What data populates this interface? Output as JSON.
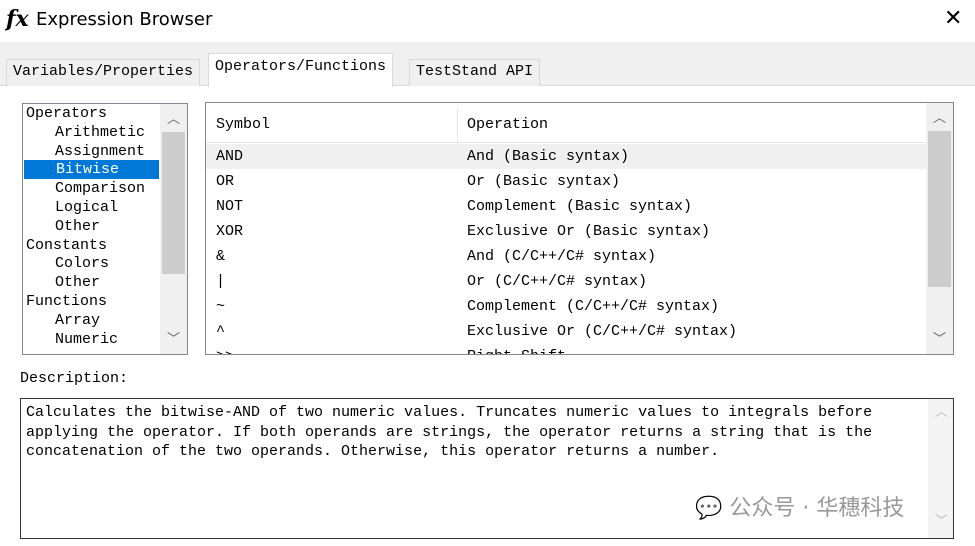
{
  "window": {
    "title": "Expression Browser",
    "icon": "fx-icon",
    "close": "✕"
  },
  "tabs": [
    {
      "label": "Variables/Properties"
    },
    {
      "label": "Operators/Functions",
      "active": true
    },
    {
      "label": "TestStand API"
    }
  ],
  "tree": {
    "items": [
      {
        "label": "Operators",
        "level": 0
      },
      {
        "label": "Arithmetic",
        "level": 1
      },
      {
        "label": "Assignment",
        "level": 1
      },
      {
        "label": "Bitwise",
        "level": 1,
        "selected": true
      },
      {
        "label": "Comparison",
        "level": 1
      },
      {
        "label": "Logical",
        "level": 1
      },
      {
        "label": "Other",
        "level": 1
      },
      {
        "label": "Constants",
        "level": 0
      },
      {
        "label": "Colors",
        "level": 1
      },
      {
        "label": "Other",
        "level": 1
      },
      {
        "label": "Functions",
        "level": 0
      },
      {
        "label": "Array",
        "level": 1
      },
      {
        "label": "Numeric",
        "level": 1
      }
    ]
  },
  "grid": {
    "headers": [
      "Symbol",
      "Operation"
    ],
    "rows": [
      [
        "AND",
        "And (Basic syntax)"
      ],
      [
        "OR",
        "Or (Basic syntax)"
      ],
      [
        "NOT",
        "Complement (Basic syntax)"
      ],
      [
        "XOR",
        "Exclusive Or (Basic syntax)"
      ],
      [
        "&",
        "And (C/C++/C# syntax)"
      ],
      [
        "|",
        "Or (C/C++/C# syntax)"
      ],
      [
        "~",
        "Complement (C/C++/C# syntax)"
      ],
      [
        "^",
        "Exclusive Or (C/C++/C# syntax)"
      ],
      [
        ">>",
        "Right Shift"
      ]
    ]
  },
  "description": {
    "label": "Description:",
    "text": "Calculates the bitwise-AND of two numeric values. Truncates numeric values to integrals before applying the operator. If both operands are strings, the operator returns a string that is the concatenation of the two operands. Otherwise, this operator returns a number."
  },
  "watermark": "公众号 · 华穗科技",
  "colors": {
    "selection": "#0078d7",
    "row_highlight": "#f0f0f0"
  }
}
